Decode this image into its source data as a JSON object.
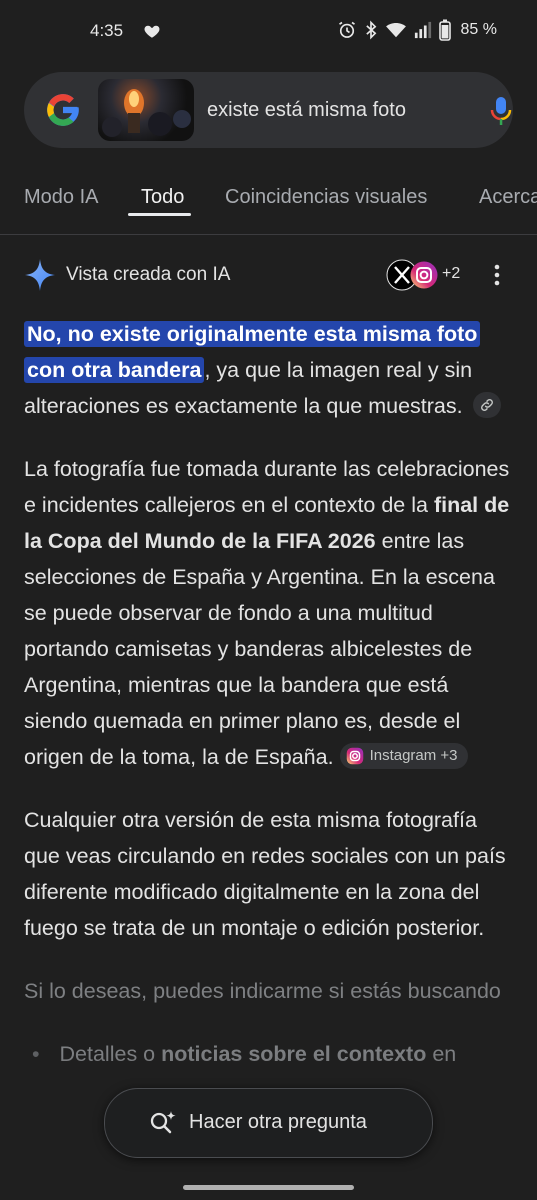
{
  "status_bar": {
    "time": "4:35",
    "battery": "85 %"
  },
  "search": {
    "query": "existe está misma foto"
  },
  "tabs": [
    {
      "label": "Modo IA"
    },
    {
      "label": "Todo"
    },
    {
      "label": "Coincidencias visuales"
    },
    {
      "label": "Acerca"
    }
  ],
  "ai_overview": {
    "title": "Vista creada con IA",
    "sources_more": "+2",
    "answer_highlight": "No, no existe originalmente esta misma foto con otra bandera",
    "answer_rest": ", ya que la imagen real y sin alteraciones es exactamente la que muestras.",
    "p2_a": "La fotografía fue tomada durante las celebraciones e incidentes callejeros en el contexto de la ",
    "p2_bold": "final de la Copa del Mundo de la FIFA 2026",
    "p2_b": " entre las selecciones de España y Argentina. En la escena se puede observar de fondo a una multitud portando camisetas y banderas albicelestes de Argentina, mientras que la bandera que está siendo quemada en primer plano es, desde el origen de la toma, la de España.",
    "p2_source": "Instagram +3",
    "p3": "Cualquier otra versión de esta misma fotografía que veas circulando en redes sociales con un país diferente modificado digitalmente en la zona del fuego se trata de un montaje o edición posterior.",
    "p4": "Si lo deseas, puedes indicarme si estás buscando",
    "bullet_a": "Detalles o ",
    "bullet_bold": "noticias sobre el contexto",
    "bullet_b": " en"
  },
  "ask_button": {
    "label": "Hacer otra pregunta"
  },
  "colors": {
    "background": "#1f1f1f",
    "highlight": "#2446ac",
    "search_bar": "#303134"
  }
}
